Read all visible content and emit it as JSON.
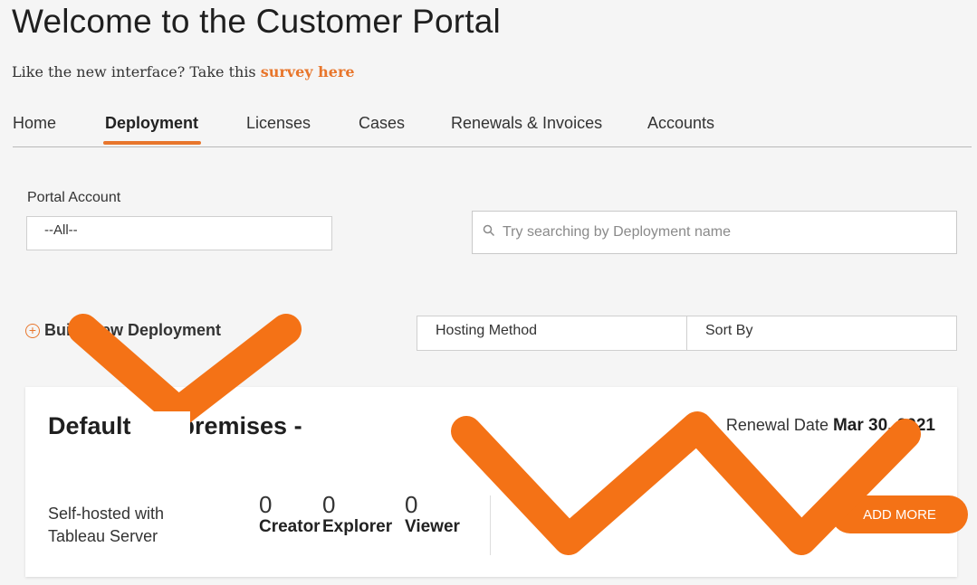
{
  "header": {
    "title": "Welcome to the Customer Portal",
    "survey_prefix": "Like the new interface? Take this ",
    "survey_link": "survey here"
  },
  "tabs": [
    {
      "label": "Home"
    },
    {
      "label": "Deployment",
      "active": true
    },
    {
      "label": "Licenses"
    },
    {
      "label": "Cases"
    },
    {
      "label": "Renewals & Invoices"
    },
    {
      "label": "Accounts"
    }
  ],
  "filters": {
    "portal_account_label": "Portal Account",
    "portal_account_value": "--All--",
    "search_placeholder": "Try searching by Deployment name",
    "build_new_label": "Build New Deployment",
    "hosting_method": "Hosting Method",
    "sort_by": "Sort By"
  },
  "deployment_card": {
    "title": "Default On-premises -",
    "renewal_label": "Renewal Date ",
    "renewal_date": "Mar 30, 2021",
    "hosting_line1": "Self-hosted with",
    "hosting_line2": "Tableau Server",
    "licenses": [
      {
        "count": "0",
        "role": "Creator"
      },
      {
        "count": "0",
        "role": "Explorer"
      },
      {
        "count": "0",
        "role": "Viewer"
      }
    ],
    "add_more": "ADD MORE"
  },
  "colors": {
    "accent": "#e8762c",
    "redaction_overlay": "#f47216",
    "background": "#f5f5f5"
  }
}
